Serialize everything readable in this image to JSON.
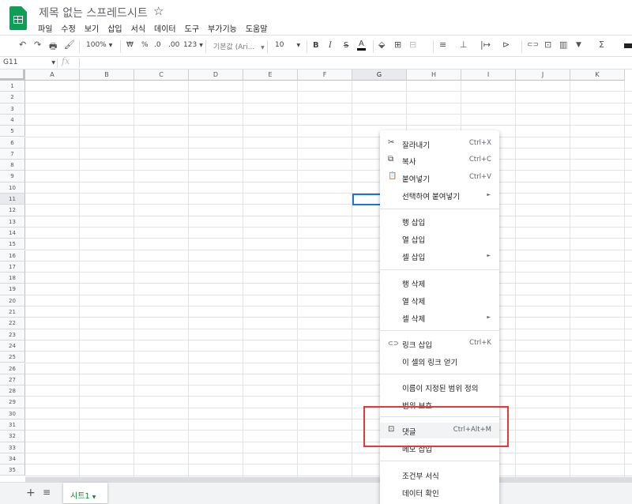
{
  "app": {
    "title": "제목 없는 스프레드시트",
    "star_glyph": "☆",
    "logo_icon": "sheets-logo-icon",
    "brand_color": "#0f9d58"
  },
  "menu": [
    "파일",
    "수정",
    "보기",
    "삽입",
    "서식",
    "데이터",
    "도구",
    "부가기능",
    "도움말"
  ],
  "toolbar": {
    "undo": "↶",
    "redo": "↷",
    "print": "🖶",
    "paint": "🖌",
    "zoom": "100%",
    "currency": "₩",
    "percent": "%",
    "decimal_less": ".0",
    "decimal_more": ".00",
    "format_more": "123",
    "font": "기본값 (Ari...",
    "font_size": "10",
    "bold": "B",
    "italic": "I",
    "strike": "S",
    "text_color": "A",
    "fill": "⬙",
    "borders": "⊞",
    "merge": "⊟",
    "align": "≡",
    "valign": "⊥",
    "wrap": "|↦",
    "rotate": "⊳",
    "link": "⊂⊃",
    "comment": "⊡",
    "chart": "▥",
    "filter": "▼",
    "functions": "Σ"
  },
  "formula_bar": {
    "cell_ref": "G11",
    "fx_label": "fx"
  },
  "grid": {
    "columns": [
      "A",
      "B",
      "C",
      "D",
      "E",
      "F",
      "G",
      "H",
      "I",
      "J",
      "K"
    ],
    "rows": [
      "1",
      "2",
      "3",
      "4",
      "5",
      "6",
      "7",
      "8",
      "9",
      "10",
      "11",
      "12",
      "13",
      "14",
      "15",
      "16",
      "17",
      "18",
      "19",
      "20",
      "21",
      "22",
      "23",
      "24",
      "25",
      "26",
      "27",
      "28",
      "29",
      "30",
      "31",
      "32",
      "33",
      "34",
      "35"
    ],
    "selected_column": "G",
    "selected_row": "11",
    "selection_color": "#1a73e8"
  },
  "sheets": {
    "add": "+",
    "list": "≡",
    "active_tab": "시트1",
    "tab_color": "#188038"
  },
  "context_menu": {
    "items": [
      {
        "icon": "✂",
        "label": "잘라내기",
        "shortcut": "Ctrl+X"
      },
      {
        "icon": "⧉",
        "label": "복사",
        "shortcut": "Ctrl+C"
      },
      {
        "icon": "📋",
        "label": "붙여넣기",
        "shortcut": "Ctrl+V"
      },
      {
        "label": "선택하여 붙여넣기"
      },
      {
        "label": "행 삽입"
      },
      {
        "label": "열 삽입"
      },
      {
        "label": "셀 삽입"
      },
      {
        "label": "행 삭제"
      },
      {
        "label": "열 삭제"
      },
      {
        "label": "셀 삭제"
      },
      {
        "icon": "⊂⊃",
        "label": "링크 삽입",
        "shortcut": "Ctrl+K"
      },
      {
        "label": "이 셀의 링크 얻기"
      },
      {
        "label": "이름이 지정된 범위 정의"
      },
      {
        "label": "범위 보호"
      },
      {
        "icon": "⊡",
        "label": "댓글",
        "shortcut": "Ctrl+Alt+M"
      },
      {
        "label": "메모 삽입"
      },
      {
        "label": "조건부 서식"
      },
      {
        "label": "데이터 확인"
      }
    ],
    "submenu_arrow": "►",
    "highlight_color": "#e53935"
  }
}
